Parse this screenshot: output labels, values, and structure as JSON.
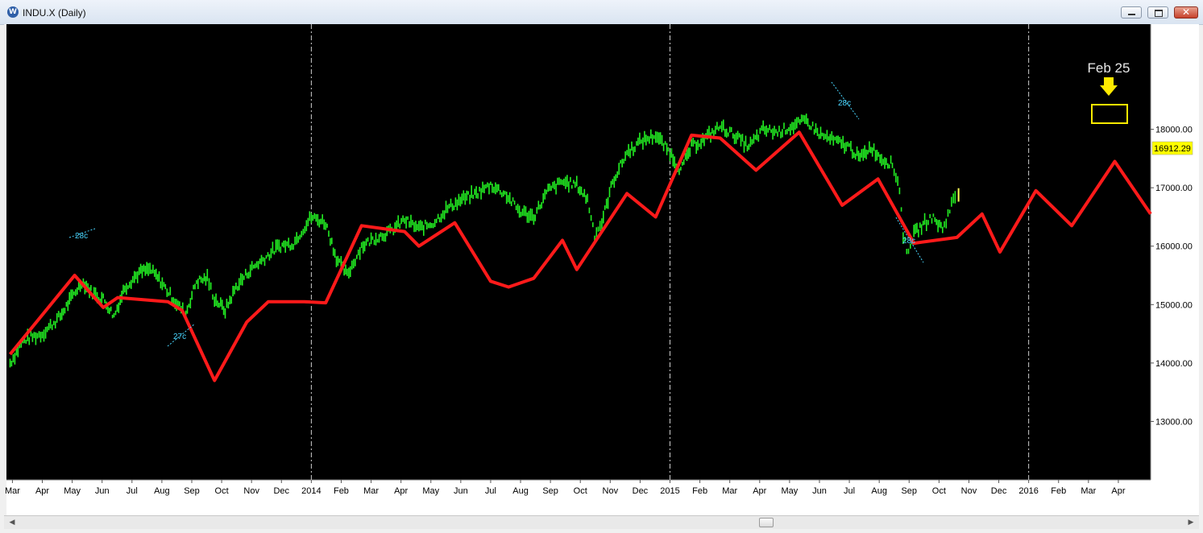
{
  "window": {
    "title": "INDU.X (Daily)",
    "icon_letter": "W",
    "buttons": {
      "minimize": "minimize",
      "maximize": "maximize",
      "close": "✕"
    }
  },
  "scrollbar": {
    "left_arrow": "◀",
    "right_arrow": "▶"
  },
  "chart_data": {
    "type": "line",
    "title": "",
    "xlabel": "",
    "ylabel": "",
    "ylim": [
      12000,
      19800
    ],
    "grid": false,
    "background": "#000000",
    "x_ticks": [
      "Mar",
      "Apr",
      "May",
      "Jun",
      "Jul",
      "Aug",
      "Sep",
      "Oct",
      "Nov",
      "Dec",
      "2014",
      "Feb",
      "Mar",
      "Apr",
      "May",
      "Jun",
      "Jul",
      "Aug",
      "Sep",
      "Oct",
      "Nov",
      "Dec",
      "2015",
      "Feb",
      "Mar",
      "Apr",
      "May",
      "Jun",
      "Jul",
      "Aug",
      "Sep",
      "Oct",
      "Nov",
      "Dec",
      "2016",
      "Feb",
      "Mar",
      "Apr"
    ],
    "y_ticks": [
      "13000.00",
      "14000.00",
      "15000.00",
      "16000.00",
      "17000.00",
      "18000.00"
    ],
    "year_dividers": [
      "2014",
      "2015",
      "2016"
    ],
    "last_price": "16912.29",
    "colors": {
      "price": "#22ee22",
      "cycle": "#ff1a1a",
      "annotation": "#49d6ff",
      "highlight": "#ffea00",
      "price_tag_bg": "#ffff00"
    },
    "series": [
      {
        "type": "bars",
        "color": "#22ee22",
        "points": [
          [
            2013.16,
            14000
          ],
          [
            2013.2,
            14400
          ],
          [
            2013.25,
            14500
          ],
          [
            2013.3,
            14800
          ],
          [
            2013.33,
            15100
          ],
          [
            2013.36,
            15400
          ],
          [
            2013.39,
            15200
          ],
          [
            2013.42,
            15100
          ],
          [
            2013.45,
            14800
          ],
          [
            2013.48,
            15300
          ],
          [
            2013.52,
            15550
          ],
          [
            2013.55,
            15600
          ],
          [
            2013.58,
            15400
          ],
          [
            2013.62,
            15050
          ],
          [
            2013.65,
            14850
          ],
          [
            2013.68,
            15400
          ],
          [
            2013.71,
            15450
          ],
          [
            2013.73,
            15100
          ],
          [
            2013.76,
            14900
          ],
          [
            2013.79,
            15300
          ],
          [
            2013.83,
            15600
          ],
          [
            2013.87,
            15800
          ],
          [
            2013.91,
            16000
          ],
          [
            2013.95,
            16050
          ],
          [
            2014.0,
            16500
          ],
          [
            2014.04,
            16400
          ],
          [
            2014.07,
            15800
          ],
          [
            2014.1,
            15500
          ],
          [
            2014.14,
            16000
          ],
          [
            2014.18,
            16150
          ],
          [
            2014.22,
            16250
          ],
          [
            2014.26,
            16450
          ],
          [
            2014.3,
            16300
          ],
          [
            2014.34,
            16400
          ],
          [
            2014.38,
            16650
          ],
          [
            2014.42,
            16800
          ],
          [
            2014.46,
            16900
          ],
          [
            2014.5,
            17050
          ],
          [
            2014.54,
            16900
          ],
          [
            2014.58,
            16600
          ],
          [
            2014.62,
            16500
          ],
          [
            2014.66,
            16950
          ],
          [
            2014.7,
            17100
          ],
          [
            2014.74,
            17050
          ],
          [
            2014.77,
            16800
          ],
          [
            2014.79,
            16200
          ],
          [
            2014.81,
            16400
          ],
          [
            2014.84,
            17100
          ],
          [
            2014.88,
            17600
          ],
          [
            2014.92,
            17800
          ],
          [
            2014.96,
            17900
          ],
          [
            2015.0,
            17600
          ],
          [
            2015.03,
            17300
          ],
          [
            2015.06,
            17700
          ],
          [
            2015.1,
            17850
          ],
          [
            2015.14,
            18050
          ],
          [
            2015.18,
            17900
          ],
          [
            2015.22,
            17700
          ],
          [
            2015.26,
            18000
          ],
          [
            2015.3,
            17950
          ],
          [
            2015.34,
            18050
          ],
          [
            2015.38,
            18150
          ],
          [
            2015.42,
            17900
          ],
          [
            2015.46,
            17800
          ],
          [
            2015.5,
            17700
          ],
          [
            2015.53,
            17500
          ],
          [
            2015.56,
            17700
          ],
          [
            2015.59,
            17500
          ],
          [
            2015.62,
            17400
          ],
          [
            2015.64,
            17000
          ],
          [
            2015.65,
            16200
          ],
          [
            2015.66,
            15900
          ],
          [
            2015.68,
            16200
          ],
          [
            2015.71,
            16400
          ],
          [
            2015.73,
            16500
          ],
          [
            2015.76,
            16300
          ],
          [
            2015.77,
            16450
          ],
          [
            2015.79,
            16800
          ],
          [
            2015.8,
            16912
          ]
        ]
      },
      {
        "type": "line",
        "color": "#ff1a1a",
        "points": [
          [
            2013.16,
            14150
          ],
          [
            2013.34,
            15500
          ],
          [
            2013.42,
            14950
          ],
          [
            2013.46,
            15120
          ],
          [
            2013.6,
            15050
          ],
          [
            2013.64,
            14900
          ],
          [
            2013.73,
            13700
          ],
          [
            2013.82,
            14700
          ],
          [
            2013.88,
            15050
          ],
          [
            2013.98,
            15050
          ],
          [
            2014.04,
            15030
          ],
          [
            2014.14,
            16350
          ],
          [
            2014.26,
            16250
          ],
          [
            2014.3,
            16000
          ],
          [
            2014.4,
            16400
          ],
          [
            2014.5,
            15400
          ],
          [
            2014.55,
            15300
          ],
          [
            2014.62,
            15450
          ],
          [
            2014.7,
            16100
          ],
          [
            2014.74,
            15600
          ],
          [
            2014.88,
            16900
          ],
          [
            2014.96,
            16500
          ],
          [
            2015.06,
            17900
          ],
          [
            2015.14,
            17850
          ],
          [
            2015.24,
            17300
          ],
          [
            2015.36,
            17950
          ],
          [
            2015.48,
            16700
          ],
          [
            2015.58,
            17150
          ],
          [
            2015.68,
            16050
          ],
          [
            2015.8,
            16150
          ],
          [
            2015.87,
            16550
          ],
          [
            2015.92,
            15900
          ],
          [
            2016.02,
            16950
          ],
          [
            2016.12,
            16350
          ],
          [
            2016.24,
            17450
          ],
          [
            2016.34,
            16550
          ]
        ]
      }
    ],
    "annotations": [
      "28c",
      "27c",
      "28c",
      "28c",
      "Feb 25"
    ]
  }
}
